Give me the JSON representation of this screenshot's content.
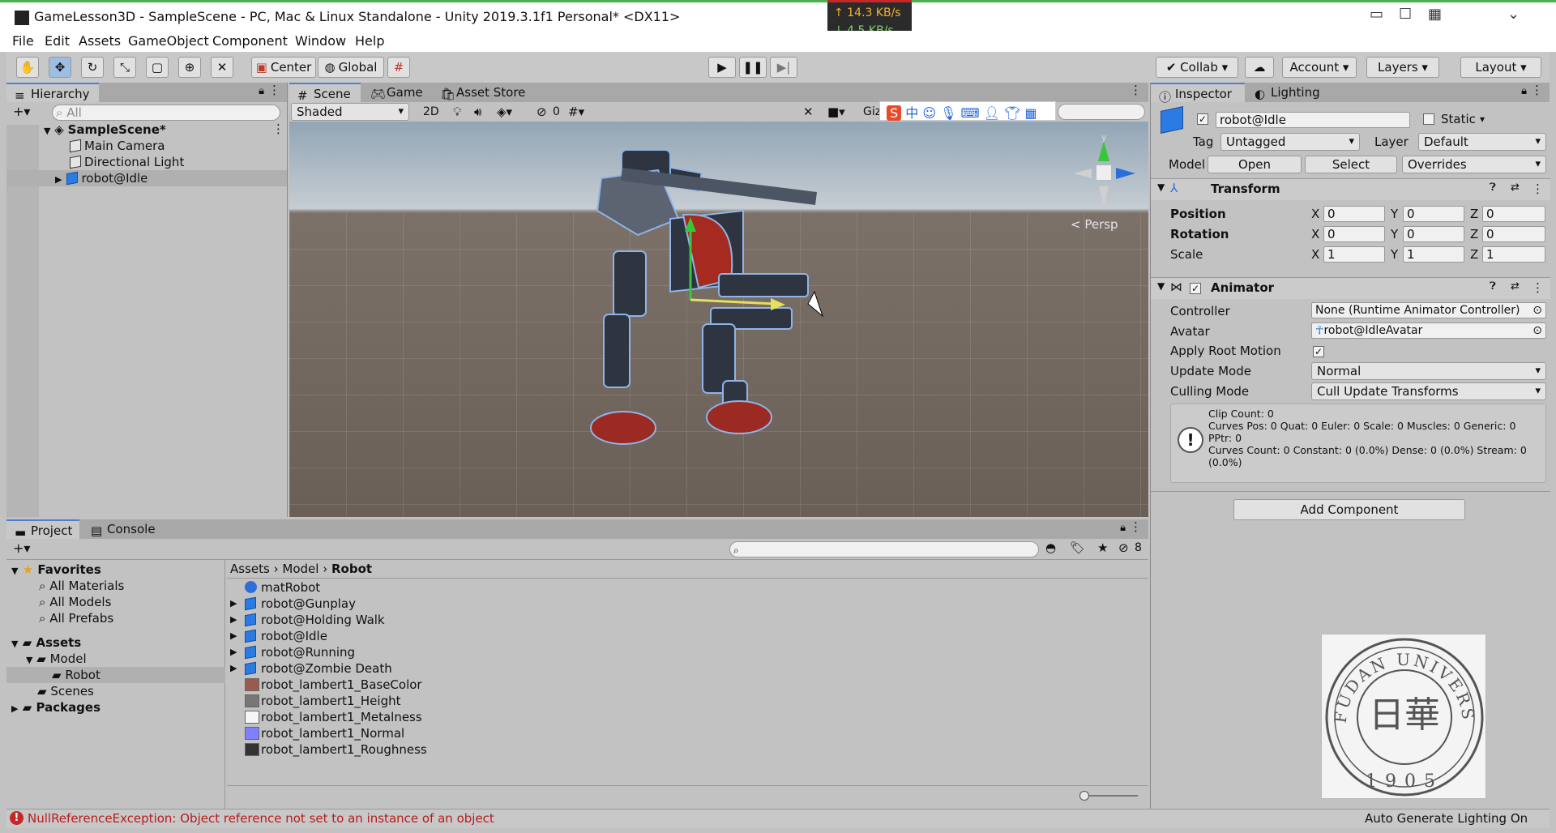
{
  "window": {
    "title": "GameLesson3D - SampleScene - PC, Mac & Linux Standalone - Unity 2019.3.1f1 Personal* <DX11>",
    "net_up": "↑ 14.3 KB/s",
    "net_down": "↓ 4.5 KB/s"
  },
  "menu": [
    "File",
    "Edit",
    "Assets",
    "GameObject",
    "Component",
    "Window",
    "Help"
  ],
  "toolbar": {
    "pivot": "Center",
    "space": "Global",
    "collab": "Collab",
    "account": "Account",
    "layers": "Layers",
    "layout": "Layout"
  },
  "hierarchy": {
    "tab": "Hierarchy",
    "search_placeholder": "All",
    "scene": "SampleScene*",
    "items": [
      "Main Camera",
      "Directional Light",
      "robot@Idle"
    ]
  },
  "scene": {
    "tabs": [
      "Scene",
      "Game",
      "Asset Store"
    ],
    "shading": "Shaded",
    "mode2d": "2D",
    "hidden_count": "0",
    "gizmos": "Giz",
    "persp": "< Persp",
    "gizmo_y": "y"
  },
  "inspector": {
    "tabs": [
      "Inspector",
      "Lighting"
    ],
    "object_name": "robot@Idle",
    "static_label": "Static",
    "tag_label": "Tag",
    "tag_value": "Untagged",
    "layer_label": "Layer",
    "layer_value": "Default",
    "model_label": "Model",
    "open_btn": "Open",
    "select_btn": "Select",
    "overrides": "Overrides",
    "transform": {
      "title": "Transform",
      "rows": [
        {
          "label": "Position",
          "x": "0",
          "y": "0",
          "z": "0"
        },
        {
          "label": "Rotation",
          "x": "0",
          "y": "0",
          "z": "0"
        },
        {
          "label": "Scale",
          "x": "1",
          "y": "1",
          "z": "1"
        }
      ],
      "x": "X",
      "y": "Y",
      "z": "Z"
    },
    "animator": {
      "title": "Animator",
      "controller_label": "Controller",
      "controller_value": "None (Runtime Animator Controller)",
      "avatar_label": "Avatar",
      "avatar_value": "robot@IdleAvatar",
      "root_motion_label": "Apply Root Motion",
      "update_label": "Update Mode",
      "update_value": "Normal",
      "culling_label": "Culling Mode",
      "culling_value": "Cull Update Transforms",
      "info": [
        "Clip Count: 0",
        "Curves Pos: 0 Quat: 0 Euler: 0 Scale: 0 Muscles: 0 Generic: 0",
        "PPtr: 0",
        "Curves Count: 0 Constant: 0 (0.0%) Dense: 0 (0.0%) Stream: 0",
        "(0.0%)"
      ]
    },
    "add_component": "Add Component"
  },
  "project": {
    "tabs": [
      "Project",
      "Console"
    ],
    "hidden_count": "8",
    "favorites": "Favorites",
    "fav_items": [
      "All Materials",
      "All Models",
      "All Prefabs"
    ],
    "assets": "Assets",
    "model": "Model",
    "robot": "Robot",
    "scenes": "Scenes",
    "packages": "Packages",
    "breadcrumb": [
      "Assets",
      "Model",
      "Robot"
    ],
    "files": [
      {
        "name": "matRobot",
        "icon": "material-icon",
        "color": "#2f6fd8",
        "expand": false
      },
      {
        "name": "robot@Gunplay",
        "icon": "model-icon",
        "color": "#2a7be4",
        "expand": true
      },
      {
        "name": "robot@Holding Walk",
        "icon": "model-icon",
        "color": "#2a7be4",
        "expand": true
      },
      {
        "name": "robot@Idle",
        "icon": "model-icon",
        "color": "#2a7be4",
        "expand": true
      },
      {
        "name": "robot@Running",
        "icon": "model-icon",
        "color": "#2a7be4",
        "expand": true
      },
      {
        "name": "robot@Zombie Death",
        "icon": "model-icon",
        "color": "#2a7be4",
        "expand": true
      },
      {
        "name": "robot_lambert1_BaseColor",
        "icon": "texture-icon",
        "color": "#9b5a4a",
        "expand": false
      },
      {
        "name": "robot_lambert1_Height",
        "icon": "texture-icon",
        "color": "#777777",
        "expand": false
      },
      {
        "name": "robot_lambert1_Metalness",
        "icon": "texture-icon",
        "color": "#f6f6f6",
        "expand": false
      },
      {
        "name": "robot_lambert1_Normal",
        "icon": "texture-icon",
        "color": "#8080ff",
        "expand": false
      },
      {
        "name": "robot_lambert1_Roughness",
        "icon": "texture-icon",
        "color": "#333333",
        "expand": false
      }
    ]
  },
  "status": {
    "error": "NullReferenceException: Object reference not set to an instance of an object",
    "lighting": "Auto Generate Lighting On"
  },
  "seal": {
    "text": "FUDAN UNIVERSITY",
    "year": "1905",
    "glyph": "日華"
  }
}
